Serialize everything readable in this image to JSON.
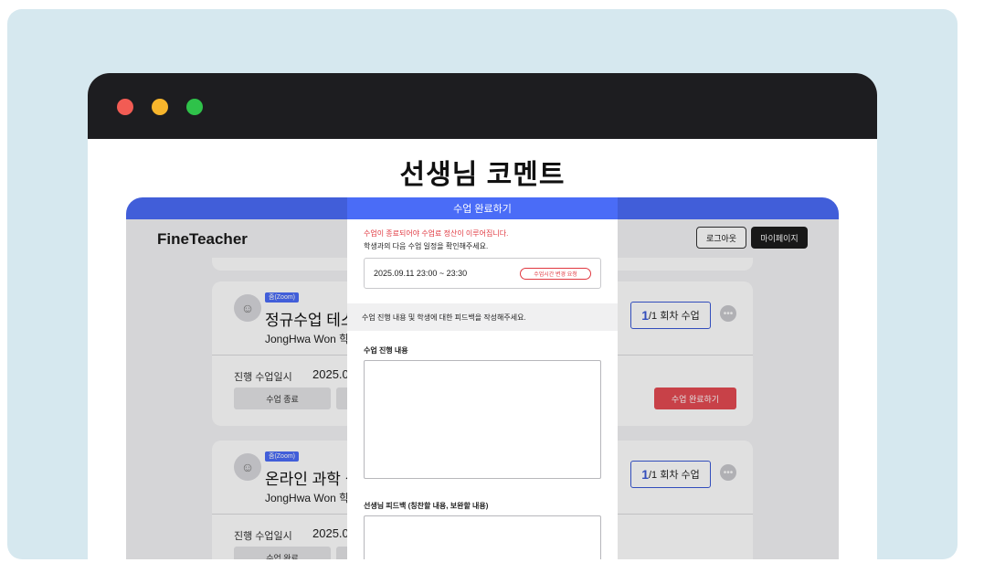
{
  "page": {
    "heading": "선생님 코멘트"
  },
  "app": {
    "logo": "FineTeacher",
    "logout_label": "로그아웃",
    "mypage_label": "마이페이지"
  },
  "cards": [
    {
      "badge": "줌(Zoom)",
      "title": "정규수업 테스",
      "teacher": "JongHwa Won 학",
      "session_current": "1",
      "session_rest": "/1 회차 수업",
      "date_label": "진행 수업일시",
      "date_value": "2025.0",
      "end_label": "수업 종료",
      "complete_label": "수업 완료하기"
    },
    {
      "badge": "줌(Zoom)",
      "title": "온라인 과학 심",
      "teacher": "JongHwa Won 학",
      "session_current": "1",
      "session_rest": "/1 회차 수업",
      "date_label": "진행 수업일시",
      "date_value": "2025.0",
      "end_label": "수업 완료"
    }
  ],
  "modal": {
    "title": "수업 완료하기",
    "warning": "수업이 종료되어야 수업료 정산이 이루어집니다.",
    "instruction": "학생과의 다음 수업 일정을 확인해주세요.",
    "time": "2025.09.11 23:00 ~ 23:30",
    "change_label": "수업시간 변경 요청",
    "feedback_prompt": "수업 진행 내용 및 학생에 대한 피드백을 작성해주세요.",
    "progress_label": "수업 진행 내용",
    "feedback_label": "선생님 피드백 (칭찬할 내용, 보완할 내용)",
    "progress_value": "",
    "feedback_value": ""
  },
  "colors": {
    "accent": "#4a6cf7",
    "danger": "#e44a52",
    "dark": "#1d1d20",
    "bg": "#d6e8ef"
  }
}
